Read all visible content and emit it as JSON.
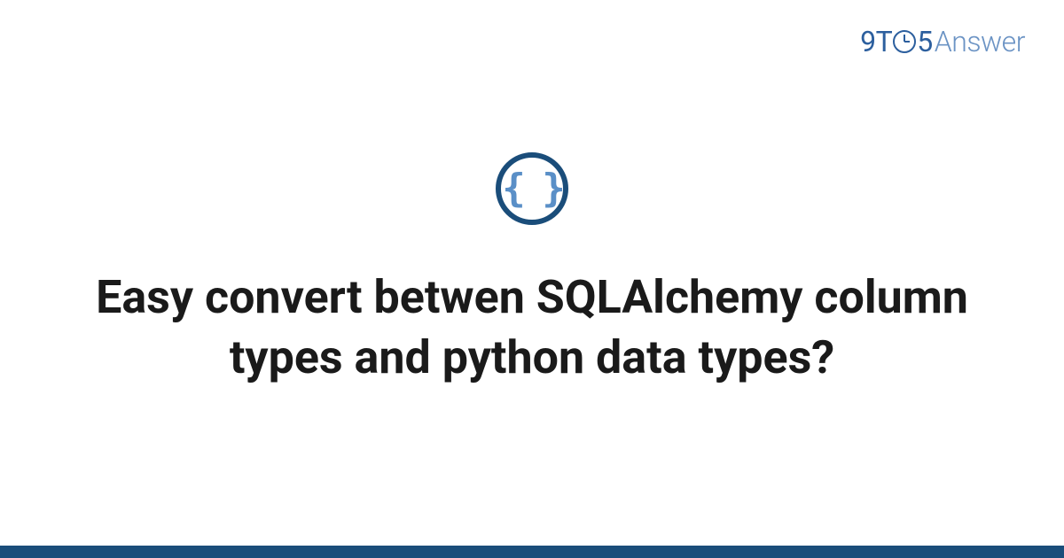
{
  "logo": {
    "nine": "9",
    "t": "T",
    "five": "5",
    "answer": "Answer"
  },
  "icon": {
    "braces": "{ }",
    "name": "code-braces-icon"
  },
  "title": "Easy convert betwen SQLAlchemy column types and python data types?",
  "colors": {
    "primary": "#1a4d7a",
    "accent": "#5a8fc7",
    "logo": "#2c5f9e"
  }
}
